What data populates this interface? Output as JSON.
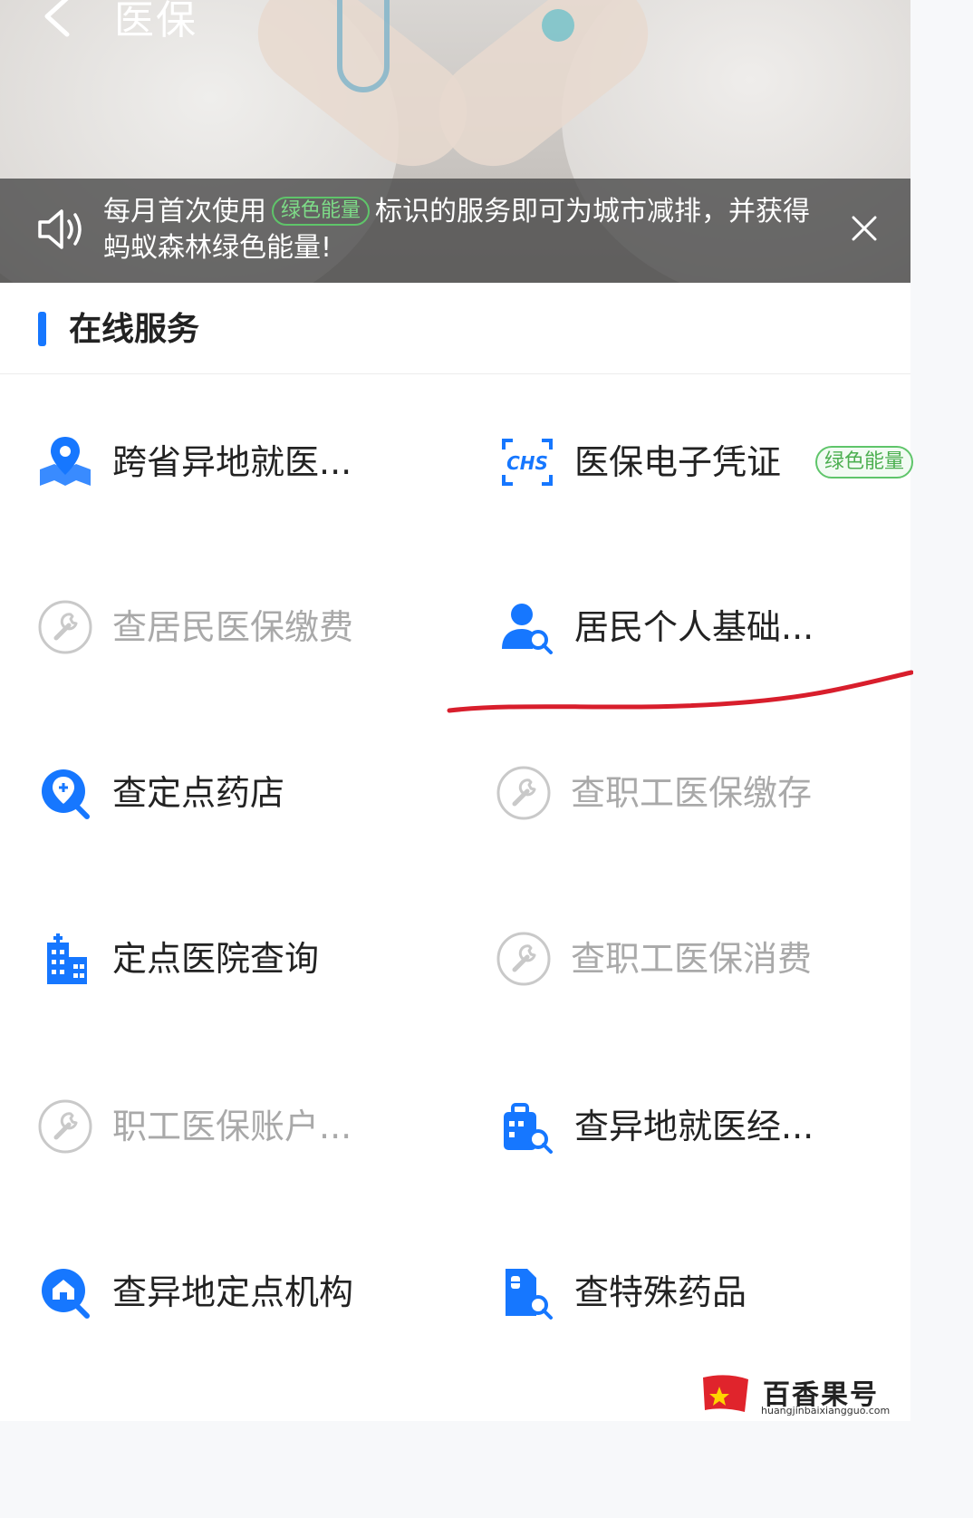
{
  "header": {
    "title": "医保",
    "back_icon": "chevron-left-icon"
  },
  "notice": {
    "text_before": "每月首次使用",
    "badge": "绿色能量",
    "text_after": "标识的服务即可为城市减排，并获得蚂蚁森林绿色能量!",
    "speaker_icon": "speaker-icon",
    "close_icon": "close-icon"
  },
  "section": {
    "title": "在线服务",
    "accent": "#1677ff"
  },
  "services": [
    {
      "label": "跨省异地就医...",
      "icon": "map-location-icon",
      "enabled": true
    },
    {
      "label": "医保电子凭证",
      "icon": "chs-scan-icon",
      "enabled": true,
      "badge": "绿色能量"
    },
    {
      "label": "查居民医保缴费",
      "icon": "wrench-icon",
      "enabled": false
    },
    {
      "label": "居民个人基础...",
      "icon": "person-search-icon",
      "enabled": true
    },
    {
      "label": "查定点药店",
      "icon": "pharmacy-search-icon",
      "enabled": true
    },
    {
      "label": "查职工医保缴存",
      "icon": "wrench-icon",
      "enabled": false
    },
    {
      "label": "定点医院查询",
      "icon": "hospital-building-icon",
      "enabled": true
    },
    {
      "label": "查职工医保消费",
      "icon": "wrench-icon",
      "enabled": false
    },
    {
      "label": "职工医保账户...",
      "icon": "wrench-icon",
      "enabled": false
    },
    {
      "label": "查异地就医经...",
      "icon": "medical-bag-search-icon",
      "enabled": true
    },
    {
      "label": "查异地定点机构",
      "icon": "institution-search-icon",
      "enabled": true
    },
    {
      "label": "查特殊药品",
      "icon": "medicine-doc-search-icon",
      "enabled": true
    }
  ],
  "colors": {
    "icon_blue": "#1677ff",
    "disabled_gray": "#a9a9a9",
    "green_badge": "#4caf50",
    "annotation_red": "#d81e2c"
  },
  "watermark": {
    "name": "百香果号",
    "url": "huangjinbaixiangguo.com"
  }
}
